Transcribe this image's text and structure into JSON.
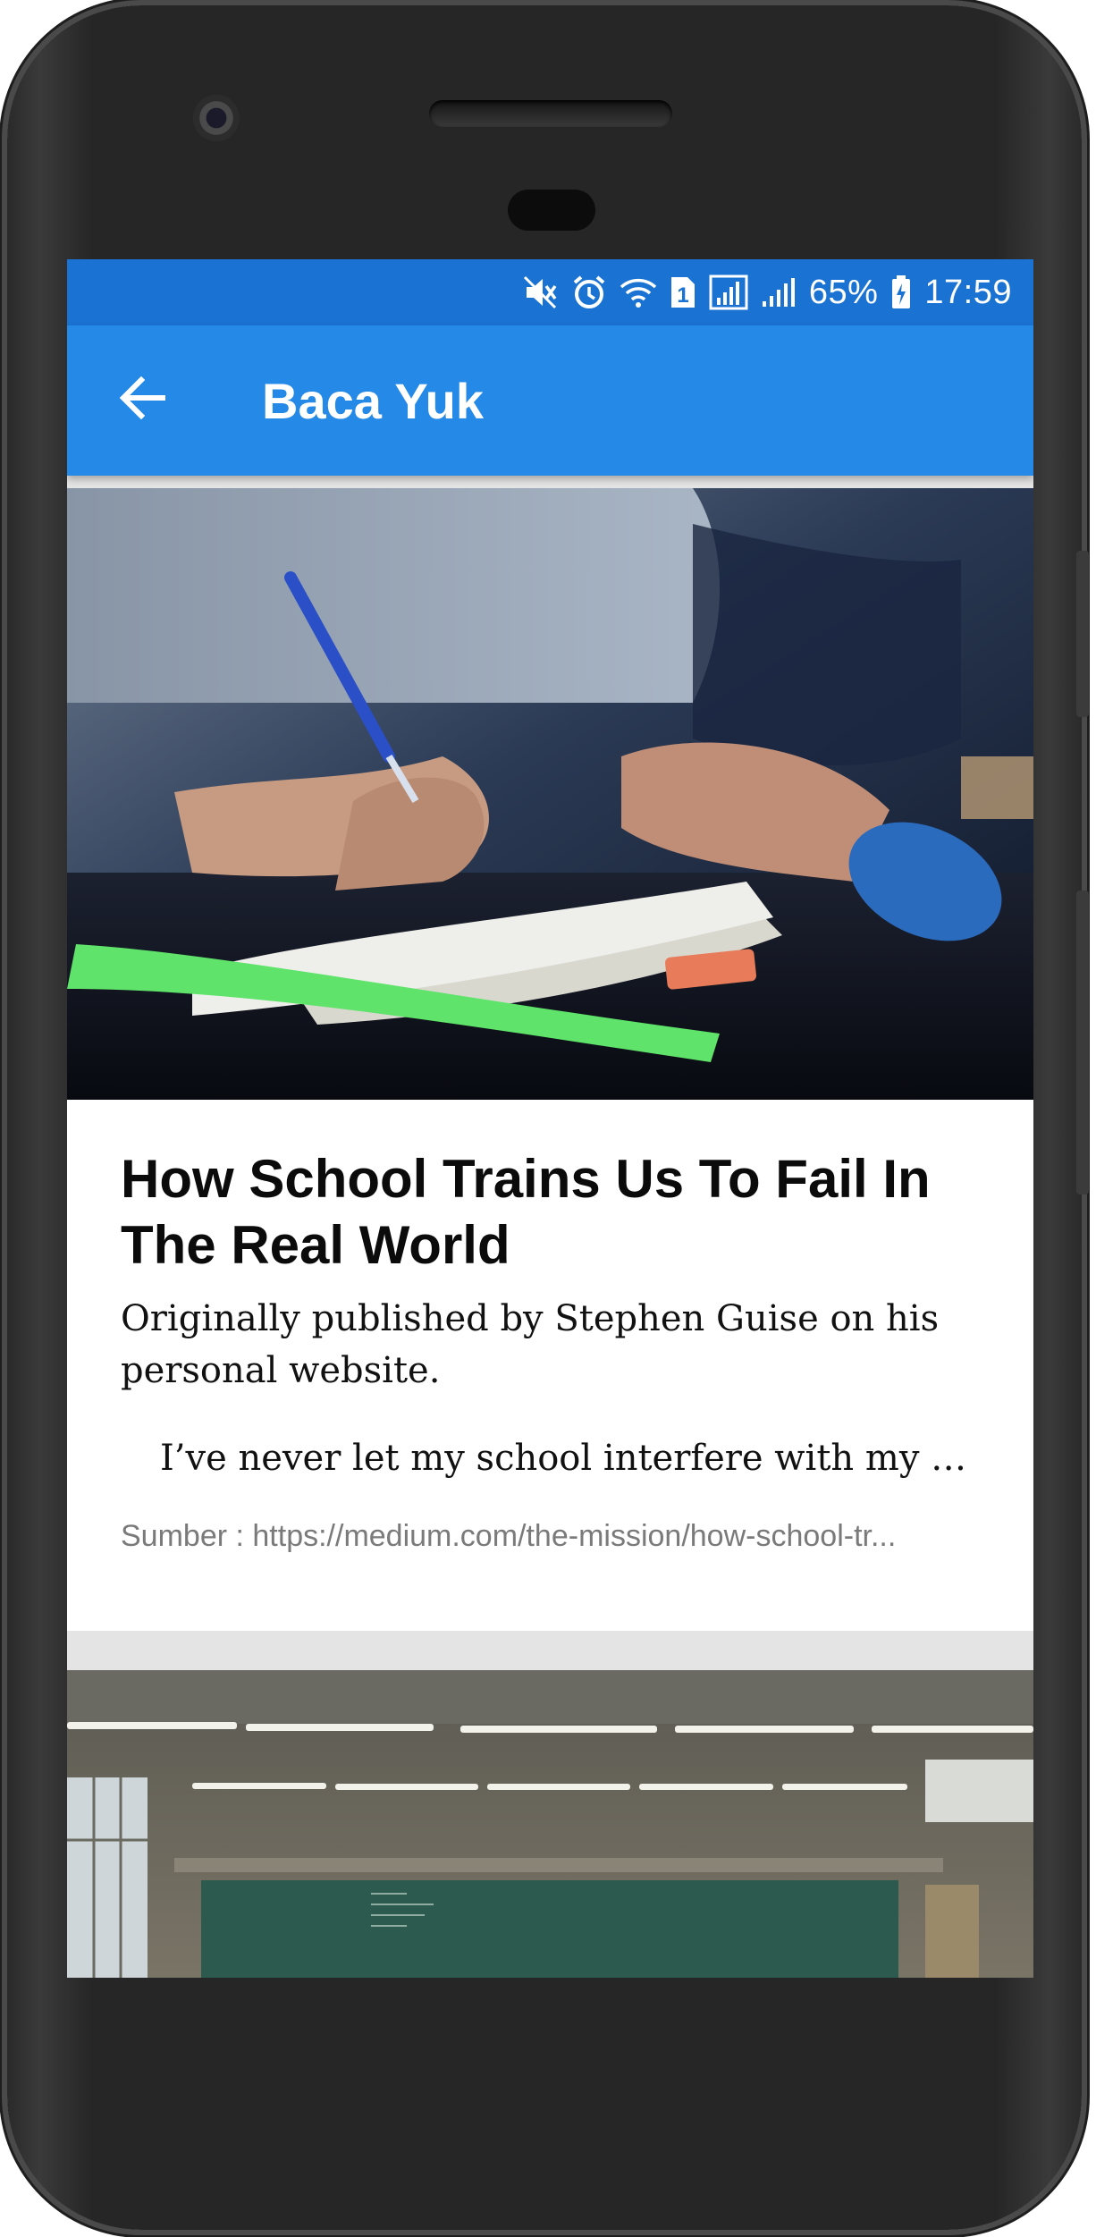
{
  "status_bar": {
    "battery_percent": "65%",
    "time": "17:59",
    "sim_slot": "1",
    "icons": [
      "mute-icon",
      "alarm-icon",
      "wifi-icon",
      "sim-icon",
      "signal-icon",
      "signal-icon",
      "battery-icon"
    ]
  },
  "app_bar": {
    "title": "Baca Yuk",
    "back_icon": "arrow-left-icon",
    "color": "#2589e8"
  },
  "articles": [
    {
      "title": "How School Trains Us To Fail In The Real World",
      "description": "Originally published by Stephen Guise on his personal website.",
      "excerpt": "I’ve never let my school interfere with my …",
      "source": "Sumber : https://medium.com/the-mission/how-school-tr..."
    }
  ],
  "colors": {
    "status_bar": "#1a73d3",
    "app_bar": "#2589e8",
    "source_text": "#7a7a7a"
  }
}
